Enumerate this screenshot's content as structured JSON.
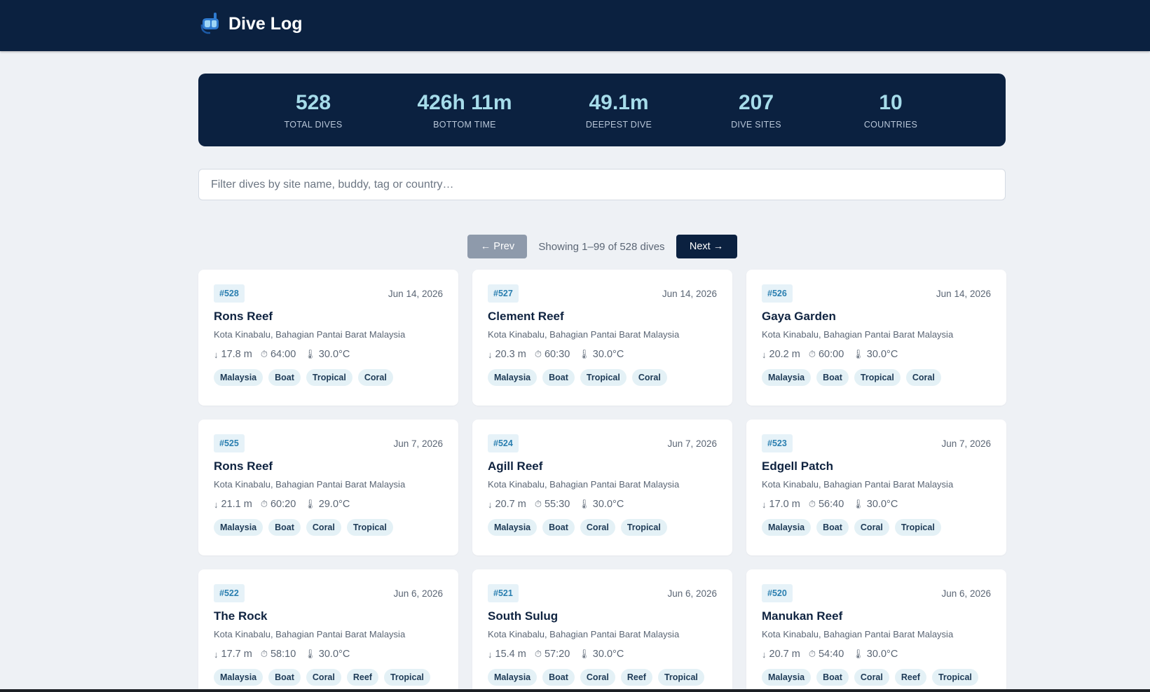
{
  "header": {
    "title": "Dive Log",
    "icon": "snorkel-mask-icon"
  },
  "stats": [
    {
      "value": "528",
      "label": "TOTAL DIVES"
    },
    {
      "value": "426h 11m",
      "label": "BOTTOM TIME"
    },
    {
      "value": "49.1m",
      "label": "DEEPEST DIVE"
    },
    {
      "value": "207",
      "label": "DIVE SITES"
    },
    {
      "value": "10",
      "label": "COUNTRIES"
    }
  ],
  "search": {
    "placeholder": "Filter dives by site name, buddy, tag or country…"
  },
  "pager": {
    "prev_label": "← Prev",
    "status": "Showing 1–99 of 528 dives",
    "next_label": "Next →"
  },
  "dives": [
    {
      "num": "#528",
      "date": "Jun 14, 2026",
      "site": "Rons Reef",
      "location": "Kota Kinabalu, Bahagian Pantai Barat  Malaysia",
      "depth": "17.8 m",
      "time": "64:00",
      "temp": "30.0°C",
      "tags": [
        "Malaysia",
        "Boat",
        "Tropical",
        "Coral"
      ]
    },
    {
      "num": "#527",
      "date": "Jun 14, 2026",
      "site": "Clement Reef",
      "location": "Kota Kinabalu, Bahagian Pantai Barat  Malaysia",
      "depth": "20.3 m",
      "time": "60:30",
      "temp": "30.0°C",
      "tags": [
        "Malaysia",
        "Boat",
        "Tropical",
        "Coral"
      ]
    },
    {
      "num": "#526",
      "date": "Jun 14, 2026",
      "site": "Gaya Garden",
      "location": "Kota Kinabalu, Bahagian Pantai Barat  Malaysia",
      "depth": "20.2 m",
      "time": "60:00",
      "temp": "30.0°C",
      "tags": [
        "Malaysia",
        "Boat",
        "Tropical",
        "Coral"
      ]
    },
    {
      "num": "#525",
      "date": "Jun 7, 2026",
      "site": "Rons Reef",
      "location": "Kota Kinabalu, Bahagian Pantai Barat  Malaysia",
      "depth": "21.1 m",
      "time": "60:20",
      "temp": "29.0°C",
      "tags": [
        "Malaysia",
        "Boat",
        "Coral",
        "Tropical"
      ]
    },
    {
      "num": "#524",
      "date": "Jun 7, 2026",
      "site": "Agill Reef",
      "location": "Kota Kinabalu, Bahagian Pantai Barat  Malaysia",
      "depth": "20.7 m",
      "time": "55:30",
      "temp": "30.0°C",
      "tags": [
        "Malaysia",
        "Boat",
        "Coral",
        "Tropical"
      ]
    },
    {
      "num": "#523",
      "date": "Jun 7, 2026",
      "site": "Edgell Patch",
      "location": "Kota Kinabalu, Bahagian Pantai Barat  Malaysia",
      "depth": "17.0 m",
      "time": "56:40",
      "temp": "30.0°C",
      "tags": [
        "Malaysia",
        "Boat",
        "Coral",
        "Tropical"
      ]
    },
    {
      "num": "#522",
      "date": "Jun 6, 2026",
      "site": "The Rock",
      "location": "Kota Kinabalu, Bahagian Pantai Barat  Malaysia",
      "depth": "17.7 m",
      "time": "58:10",
      "temp": "30.0°C",
      "tags": [
        "Malaysia",
        "Boat",
        "Coral",
        "Reef",
        "Tropical"
      ]
    },
    {
      "num": "#521",
      "date": "Jun 6, 2026",
      "site": "South Sulug",
      "location": "Kota Kinabalu, Bahagian Pantai Barat  Malaysia",
      "depth": "15.4 m",
      "time": "57:20",
      "temp": "30.0°C",
      "tags": [
        "Malaysia",
        "Boat",
        "Coral",
        "Reef",
        "Tropical"
      ]
    },
    {
      "num": "#520",
      "date": "Jun 6, 2026",
      "site": "Manukan Reef",
      "location": "Kota Kinabalu, Bahagian Pantai Barat  Malaysia",
      "depth": "20.7 m",
      "time": "54:40",
      "temp": "30.0°C",
      "tags": [
        "Malaysia",
        "Boat",
        "Coral",
        "Reef",
        "Tropical"
      ]
    }
  ],
  "icons": {
    "depth": "↓",
    "time": "⏱",
    "temp": "🌡"
  },
  "colors": {
    "header_bg": "#0b2140",
    "accent": "#a6dcea",
    "tag_bg": "#e4f1f6",
    "num_text": "#2a7fb0"
  }
}
